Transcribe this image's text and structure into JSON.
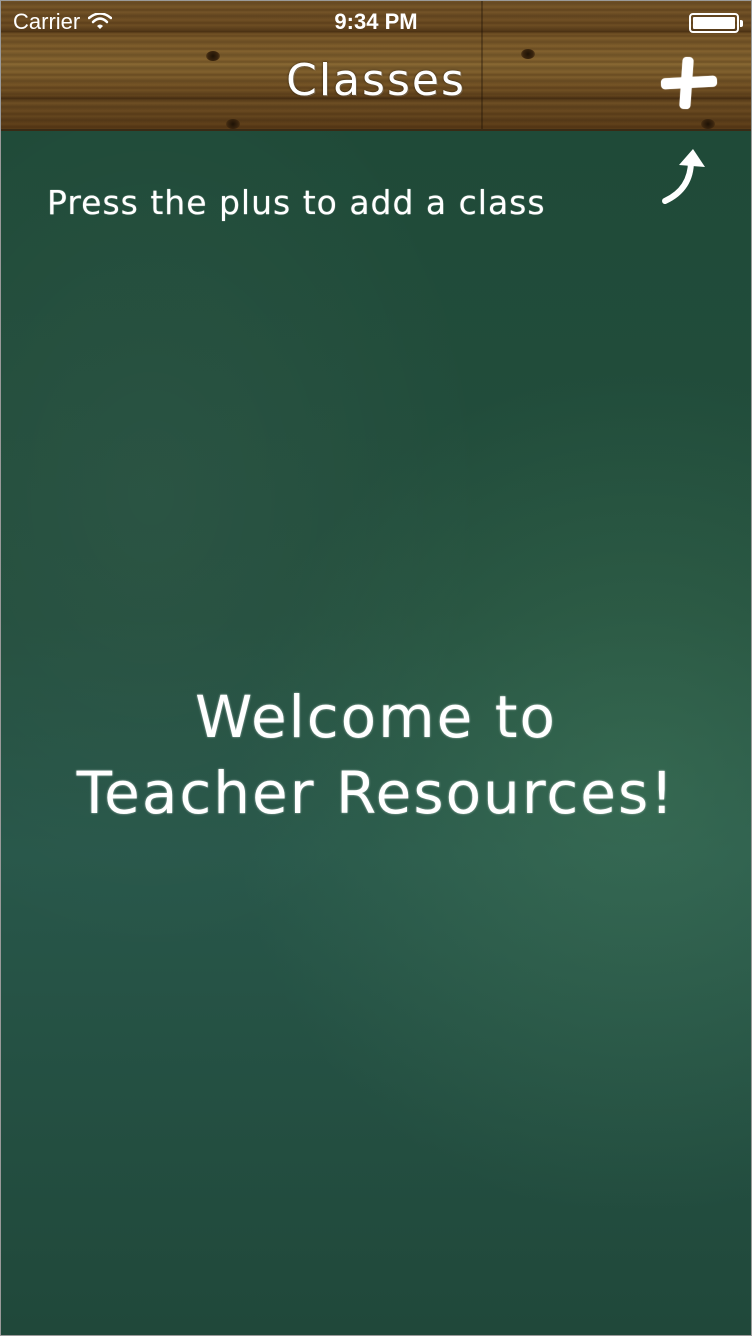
{
  "status_bar": {
    "carrier": "Carrier",
    "time": "9:34 PM",
    "battery_level": 1.0
  },
  "nav": {
    "title": "Classes",
    "add_icon": "plus-icon"
  },
  "hint": {
    "text": "Press the plus to add a class",
    "arrow_icon": "curved-arrow-up-icon"
  },
  "welcome": {
    "line1": "Welcome to",
    "line2": "Teacher Resources!"
  },
  "colors": {
    "chalkboard": "#234e3d",
    "wood": "#6b4b22",
    "chalk": "#ffffff"
  }
}
